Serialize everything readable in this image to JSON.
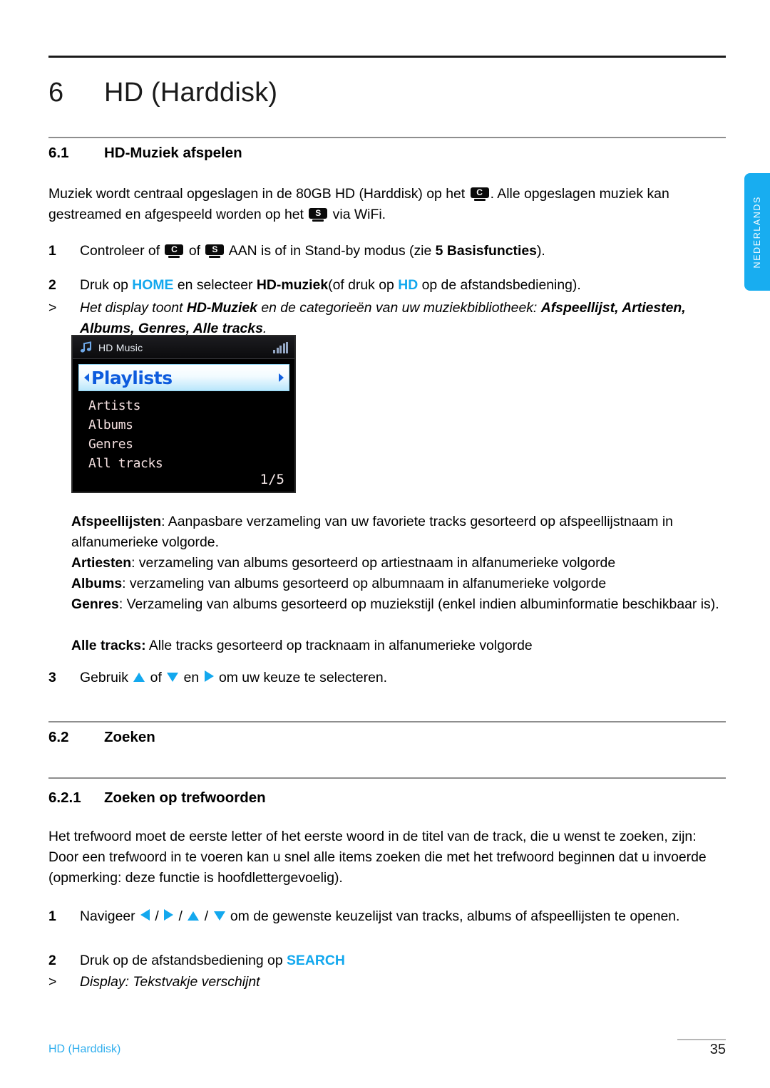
{
  "chapter": {
    "number": "6",
    "title": "HD (Harddisk)"
  },
  "sections": {
    "s61": {
      "number": "6.1",
      "title": "HD-Muziek afspelen"
    },
    "s62": {
      "number": "6.2",
      "title": "Zoeken"
    },
    "s621": {
      "number": "6.2.1",
      "title": "Zoeken op trefwoorden"
    }
  },
  "intro": {
    "p1a": "Muziek wordt centraal opgeslagen in de 80GB HD (Harddisk) op het ",
    "p1b": ". Alle opgeslagen muziek kan gestreamed en afgespeeld worden op het ",
    "p1c": " via WiFi."
  },
  "steps": {
    "s1": {
      "marker": "1",
      "a": "Controleer of ",
      "b": " of ",
      "c": " AAN is of in Stand-by modus (zie ",
      "bold": "5 Basisfuncties",
      "d": ")."
    },
    "s2": {
      "marker": "2",
      "a": "Druk op ",
      "home": "HOME",
      "b": " en selecteer ",
      "bold1": "HD-muziek",
      "c": "(of druk op ",
      "hd": "HD",
      "d": " op de afstandsbediening)."
    },
    "note1": {
      "marker": ">",
      "a": "Het display toont ",
      "bold1": "HD-Muziek",
      "b": " en de categorieën van uw muziekbibliotheek: ",
      "bold2": "Afspeellijst, Artiesten, Albums, Genres, Alle tracks",
      "c": "."
    },
    "s3": {
      "marker": "3",
      "a": "Gebruik ",
      "b": " of ",
      "c": " en ",
      "d": " om uw keuze te selecteren."
    },
    "s621_1": {
      "marker": "1",
      "a": "Navigeer ",
      "sep1": " / ",
      "sep2": " / ",
      "sep3": " / ",
      "b": " om de gewenste keuzelijst van tracks, albums of afspeellijsten te openen."
    },
    "s621_2": {
      "marker": "2",
      "a": "Druk op de afstandsbediening op ",
      "search": "SEARCH"
    },
    "note2": {
      "marker": ">",
      "text": "Display: Tekstvakje verschijnt"
    }
  },
  "definitions": [
    {
      "term": "Afspeellijsten",
      "sep": ": ",
      "desc": "Aanpasbare verzameling van uw favoriete tracks gesorteerd op afspeellijstnaam in alfanumerieke volgorde."
    },
    {
      "term": "Artiesten",
      "sep": ": ",
      "desc": "verzameling van albums gesorteerd op artiestnaam in alfanumerieke volgorde"
    },
    {
      "term": "Albums",
      "sep": ": ",
      "desc": "verzameling van albums gesorteerd op albumnaam in alfanumerieke volgorde"
    },
    {
      "term": "Genres",
      "sep": ": ",
      "desc": "Verzameling van albums gesorteerd op muziekstijl (enkel indien albuminformatie beschikbaar is)."
    },
    {
      "term": "Alle tracks:",
      "sep": " ",
      "desc": "Alle tracks gesorteerd op tracknaam in alfanumerieke volgorde"
    }
  ],
  "keyword_para": "Het trefwoord moet de eerste letter of het eerste woord in de titel van de track, die u wenst te zoeken, zijn: Door een trefwoord in te voeren kan u snel alle items zoeken die met het trefwoord beginnen dat u invoerde (opmerking: deze functie is hoofdlettergevoelig).",
  "device_screen": {
    "title": "HD Music",
    "selected": "Playlists",
    "items": [
      "Artists",
      "Albums",
      "Genres",
      "All tracks"
    ],
    "page": "1/5",
    "icons": {
      "music_note": "music-note-icon",
      "signal": "signal-bars-icon"
    }
  },
  "badges": {
    "center": "C",
    "station": "S"
  },
  "side_tab": {
    "label": "NEDERLANDS"
  },
  "footer": {
    "left": "HD (Harddisk)",
    "page": "35"
  },
  "colors": {
    "accent_blue": "#13A8EE",
    "tab_blue": "#18ADF0",
    "footer_blue": "#2FAEEE",
    "device_selected_text": "#0D5BDD",
    "device_list_text": "#F2DEDE"
  }
}
